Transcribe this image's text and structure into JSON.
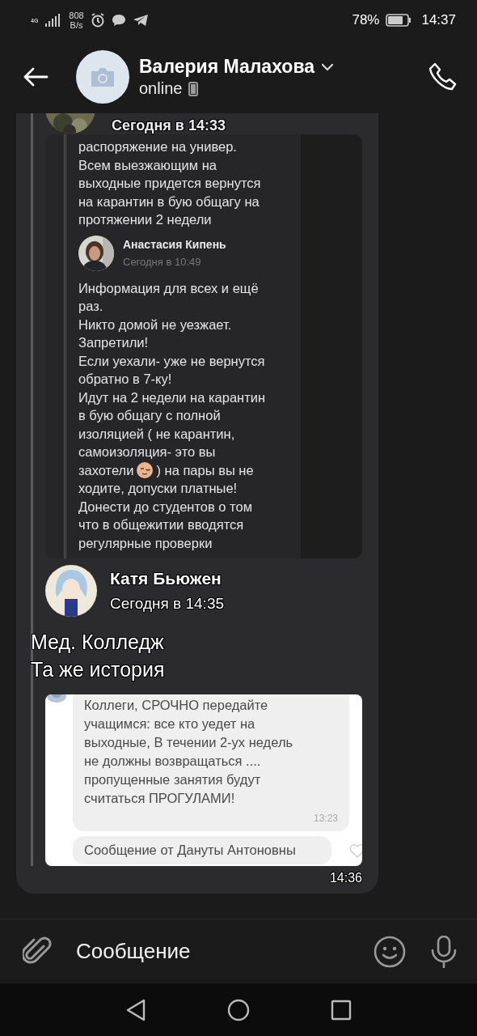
{
  "status_bar": {
    "network": "4G",
    "speed": "808\nB/s",
    "battery": "78%",
    "time": "14:37"
  },
  "header": {
    "name": "Валерия Малахова",
    "status": "online"
  },
  "message": {
    "time": "14:36",
    "forwarded": [
      {
        "kind": "screenshot_dark",
        "time": "Сегодня в 14:33",
        "text": "распоряжение на универ.\nВсем выезжающим на\nвыходные придется вернутся\nна карантин в бую общагу на\nпротяжении 2 недели",
        "author": {
          "name": "Анастасия Кипень",
          "time": "Сегодня в 10:49"
        },
        "body_before": "Информация для всех и ещё\nраз.\nНикто домой не уезжает.\nЗапретили!\nЕсли уехали- уже  не вернутся\nобратно в 7-ку!\nИдут на 2 недели на карантин\nв бую общагу с полной\nизоляцией ( не карантин,\nсамоизоляция- это вы",
        "emoji_line": {
          "before": "захотели",
          "after": ") на пары вы не"
        },
        "body_after": "ходите, допуски платные!\nДонести до студентов о том\nчто в общежитии вводятся\nрегулярные проверки"
      },
      {
        "kind": "post",
        "author": "Катя Бьюжен",
        "time": "Сегодня в 14:35",
        "text": "Мед. Колледж\nТа же история"
      },
      {
        "kind": "screenshot_light",
        "bubbles": [
          {
            "text": "Коллеги, СРОЧНО передайте\nучащимся: все кто уедет на\nвыходные, В течении 2-ух недель\nне должны возвращаться ....\nпропущенные занятия будут\nсчитаться ПРОГУЛАМИ!",
            "time": "13:23"
          },
          {
            "text": "Сообщение от Дануты Антоновны"
          }
        ]
      }
    ]
  },
  "composer": {
    "placeholder": "Сообщение"
  }
}
